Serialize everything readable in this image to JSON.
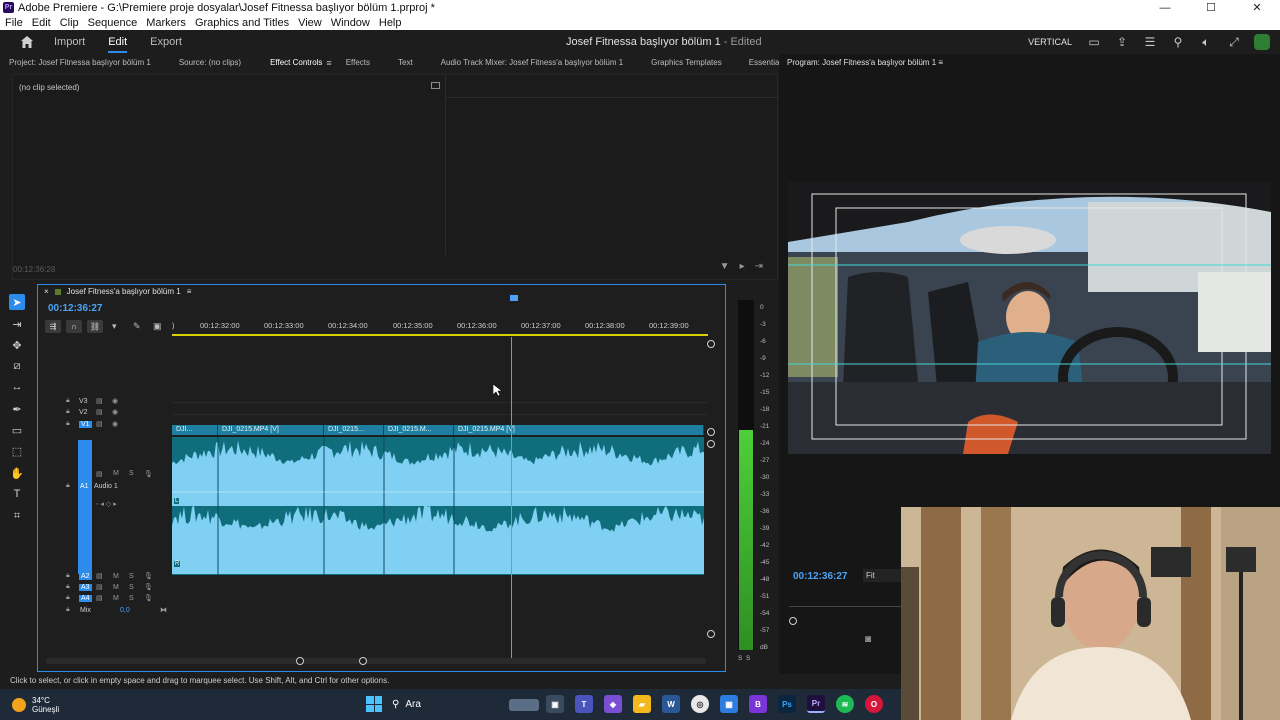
{
  "window": {
    "title": "Adobe Premiere - G:\\Premiere proje dosyalar\\Josef Fitnessa başlıyor bölüm 1.prproj *",
    "app_badge": "Pr",
    "controls": [
      "—",
      "☐",
      "✕"
    ]
  },
  "menu": [
    "File",
    "Edit",
    "Clip",
    "Sequence",
    "Markers",
    "Graphics and Titles",
    "View",
    "Window",
    "Help"
  ],
  "header": {
    "workspaces": [
      "Import",
      "Edit",
      "Export"
    ],
    "active_workspace": "Edit",
    "doc_title": "Josef Fitnessa başlıyor bölüm 1",
    "doc_status": "- Edited",
    "vertical_label": "VERTICAL"
  },
  "panel_tabs": [
    "Project: Josef Fitnessa başlıyor bölüm 1",
    "Source: (no clips)",
    "Effect Controls",
    "Effects",
    "Text",
    "Audio Track Mixer: Josef Fitness'a başlıyor bölüm 1",
    "Graphics Templates",
    "Essential Sound"
  ],
  "active_panel_tab": "Effect Controls",
  "overflow_label": "»",
  "effect_controls": {
    "no_clip": "(no clip selected)",
    "timecode": "00:12:36:28"
  },
  "program": {
    "title": "Program: Josef Fitness'a başlıyor bölüm 1",
    "timecode": "00:12:36:27",
    "fit_label": "Fit"
  },
  "timeline": {
    "sequence_name": "Josef Fitness'a başlıyor bölüm 1",
    "timecode": "00:12:36:27",
    "ruler_labels": [
      "00:12:32:00",
      "00:12:33:00",
      "00:12:34:00",
      "00:12:35:00",
      "00:12:36:00",
      "00:12:37:00",
      "00:12:38:00",
      "00:12:39:00"
    ],
    "video_tracks": [
      "V3",
      "V2",
      "V1"
    ],
    "audio_tracks": [
      "A1",
      "A2",
      "A3",
      "A4"
    ],
    "a1_name": "Audio 1",
    "mix_label": "Mix",
    "mix_value": "0,0",
    "video_clips": [
      "DJI...",
      "DJI_0215.MP4 [V]",
      "DJI_0215...",
      "DJI_0215.M...",
      "DJI_0215.MP4 [V]"
    ],
    "audio_channel_labels": [
      "L",
      "R"
    ],
    "track_toggles": {
      "mute": "M",
      "solo": "S"
    }
  },
  "meter_labels": [
    "0",
    "-3",
    "-6",
    "-9",
    "-12",
    "-15",
    "-18",
    "-21",
    "-24",
    "-27",
    "-30",
    "-33",
    "-36",
    "-39",
    "-42",
    "-45",
    "-48",
    "-51",
    "-54",
    "-57",
    "dB"
  ],
  "meter_solo": [
    "S",
    "S"
  ],
  "status_text": "Click to select, or click in empty space and drag to marquee select. Use Shift, Alt, and Ctrl for other options.",
  "taskbar": {
    "temperature": "34°C",
    "condition": "Güneşli",
    "search_label": "Ara"
  },
  "colors": {
    "accent_blue": "#2d8ceb",
    "timecode_blue": "#4da3f5",
    "clip_teal": "#1f7fa0",
    "waveform": "#7fd0f2",
    "work_area": "#d7d000",
    "meter_green": "#4ecf3a"
  }
}
